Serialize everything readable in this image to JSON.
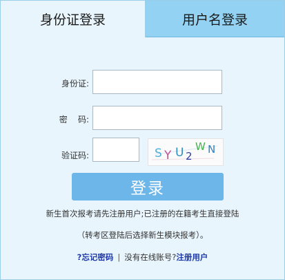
{
  "tabs": {
    "id_card_login": "身份证登录",
    "username_login": "用户名登录"
  },
  "form": {
    "id_label": "身份证:",
    "id_value": "",
    "password_label": "密    码:",
    "password_value": "",
    "captcha_label": "验证码:",
    "captcha_value": "",
    "captcha_text": "SYU2WN",
    "login_button": "登录"
  },
  "notes": {
    "line1": "新生首次报考请先注册用户;已注册的在籍考生直接登陆",
    "line2": "（转考区登陆后选择新生模块报考）。"
  },
  "links": {
    "forgot_password": "?忘记密码",
    "separator": "|",
    "no_account": "没有在线账号?",
    "register": "注册用户"
  },
  "colors": {
    "panel_bg": "#e8f5fc",
    "inactive_tab": "#93d2f2",
    "button": "#6cb6ea",
    "link": "#1f3aa8"
  }
}
